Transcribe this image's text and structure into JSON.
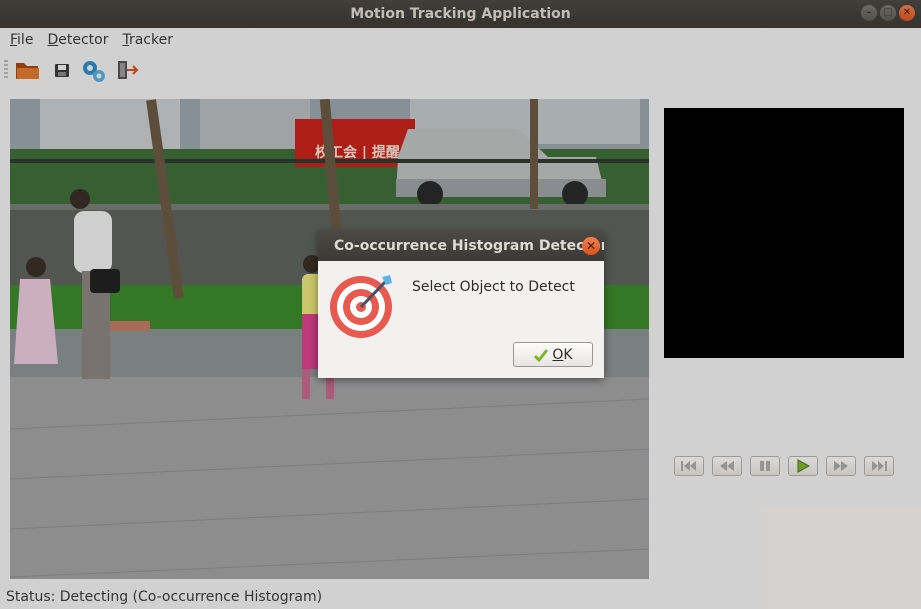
{
  "window": {
    "title": "Motion Tracking Application"
  },
  "menu": [
    "File",
    "Detector",
    "Tracker"
  ],
  "toolbar": {
    "icons": [
      "open-folder-icon",
      "save-icon",
      "settings-gears-icon",
      "exit-icon"
    ]
  },
  "video": {
    "banner_text": "校工会 | 提醒,有氧,民"
  },
  "controls": {
    "icons": [
      "skip-to-start-icon",
      "rewind-icon",
      "pause-icon",
      "play-icon",
      "fast-forward-icon",
      "skip-to-end-icon"
    ],
    "play_color": "#7fb62b"
  },
  "status": {
    "text": "Status: Detecting (Co-occurrence Histogram)"
  },
  "dialog": {
    "title": "Co-occurrence Histogram Detector",
    "message": "Select Object to Detect",
    "ok_label": "OK",
    "icon": "target-dart-icon"
  },
  "colors": {
    "titlebar": "#3c3b37",
    "close_button": "#e95420",
    "preview": "#000000"
  }
}
